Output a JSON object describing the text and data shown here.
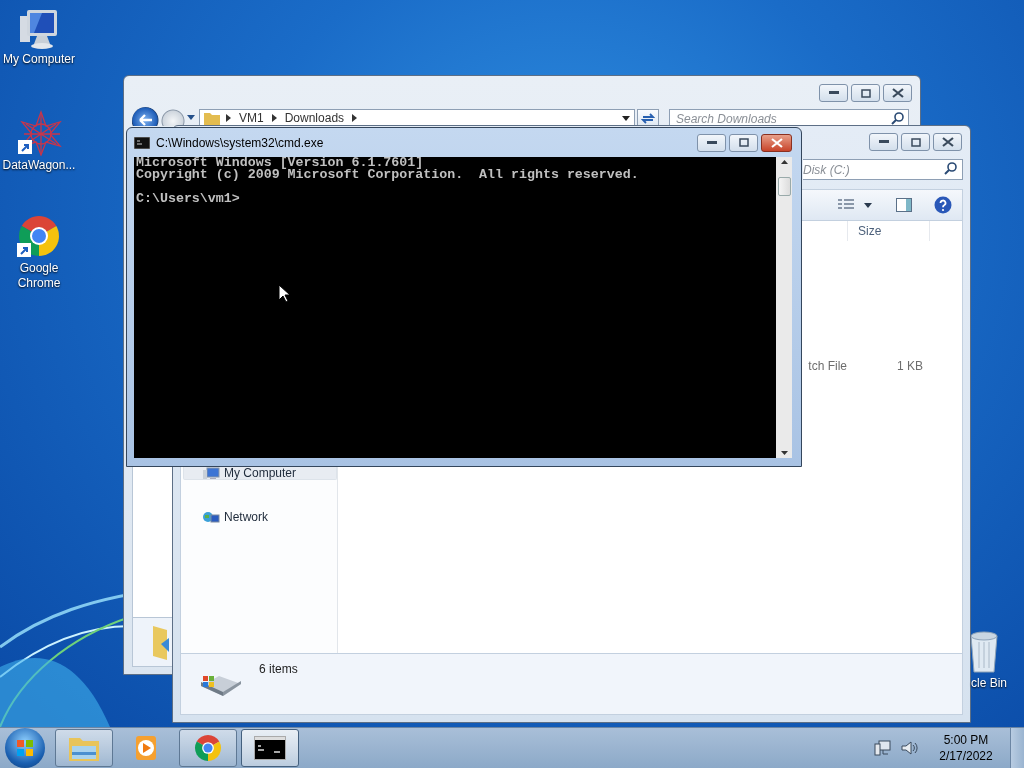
{
  "desktop_icons": [
    {
      "label": "My Computer",
      "kind": "computer"
    },
    {
      "label": "DataWagon...",
      "kind": "mesh"
    },
    {
      "label": "Google Chrome",
      "kind": "chrome"
    },
    {
      "label": "cle Bin",
      "kind": "recycle"
    }
  ],
  "downloads_window": {
    "breadcrumbs": [
      "VM1",
      "Downloads"
    ],
    "search": {
      "placeholder": "Search Downloads"
    }
  },
  "computer_window": {
    "search": {
      "placeholder": "Disk (C:)"
    },
    "columns": [
      "Size"
    ],
    "rows": [
      {
        "type": "tch File",
        "size": "1 KB"
      }
    ],
    "nav_items": [
      {
        "label": "My Computer",
        "selected": true
      },
      {
        "label": "Network",
        "selected": false
      }
    ],
    "status": "6 items"
  },
  "cmd_window": {
    "title": "C:\\Windows\\system32\\cmd.exe",
    "output": "Microsoft Windows [Version 6.1.7601]\nCopyright (c) 2009 Microsoft Corporation.  All rights reserved.\n\nC:\\Users\\vm1>"
  },
  "taskbar": {
    "buttons": [
      {
        "kind": "explorer",
        "running": true,
        "selected": false
      },
      {
        "kind": "media",
        "running": false,
        "selected": false
      },
      {
        "kind": "chrome",
        "running": true,
        "selected": false
      },
      {
        "kind": "cmd",
        "running": true,
        "selected": true
      }
    ],
    "clock": {
      "time": "5:00 PM",
      "date": "2/17/2022"
    }
  }
}
